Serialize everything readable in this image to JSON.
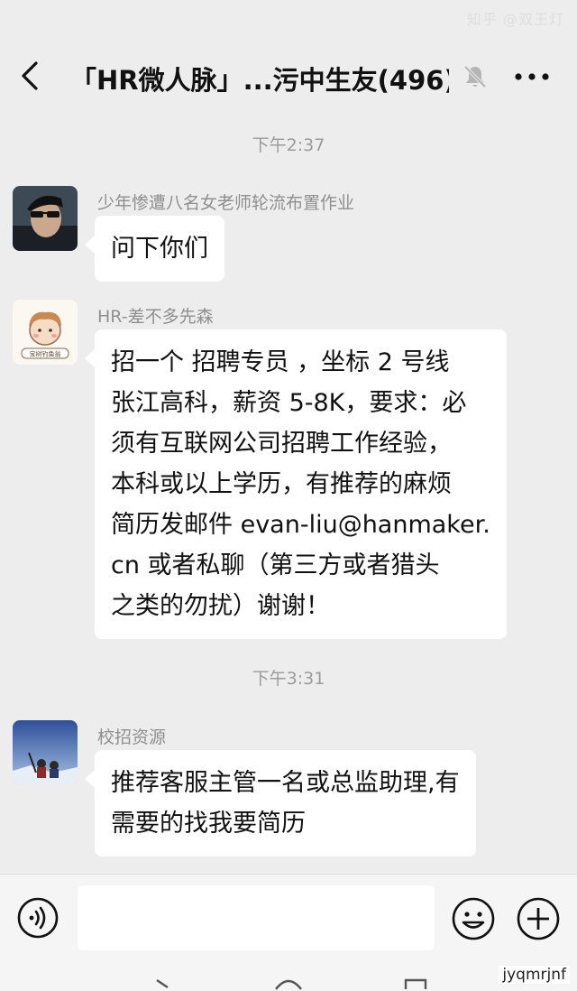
{
  "status_bar": {
    "watermark": "知乎 @双王灯"
  },
  "header": {
    "title": "「HR微人脉」...污中生友(496)",
    "back_icon": "back-chevron-icon",
    "mute_icon": "bell-muted-icon",
    "more_icon": "more-dots-icon"
  },
  "messages": [
    {
      "timestamp": "下午2:37",
      "sender": "少年惨遭八名女老师轮流布置作业",
      "lines": [
        "问下你们"
      ]
    },
    {
      "sender": "HR-差不多先森",
      "avatar_caption": "宝树钓鱼翁",
      "lines": [
        "招一个  招聘专员   ，坐标 2 号线",
        "张江高科，薪资 5-8K，要求：必",
        "须有互联网公司招聘工作经验，",
        "本科或以上学历，有推荐的麻烦",
        "简历发邮件 evan-liu@hanmaker.",
        "cn    或者私聊（第三方或者猎头",
        "之类的勿扰）谢谢！"
      ]
    },
    {
      "timestamp": "下午3:31",
      "sender": "校招资源",
      "lines": [
        "推荐客服主管一名或总监助理,有",
        "需要的找我要简历"
      ]
    }
  ],
  "input_bar": {
    "voice_icon": "voice-icon",
    "emoji_icon": "emoji-icon",
    "plus_icon": "plus-icon",
    "text_value": ""
  },
  "watermark_bottom": "jyqmrjnf",
  "colors": {
    "background": "#ededed",
    "bubble": "#ffffff",
    "meta_text": "#9b9b9b"
  }
}
